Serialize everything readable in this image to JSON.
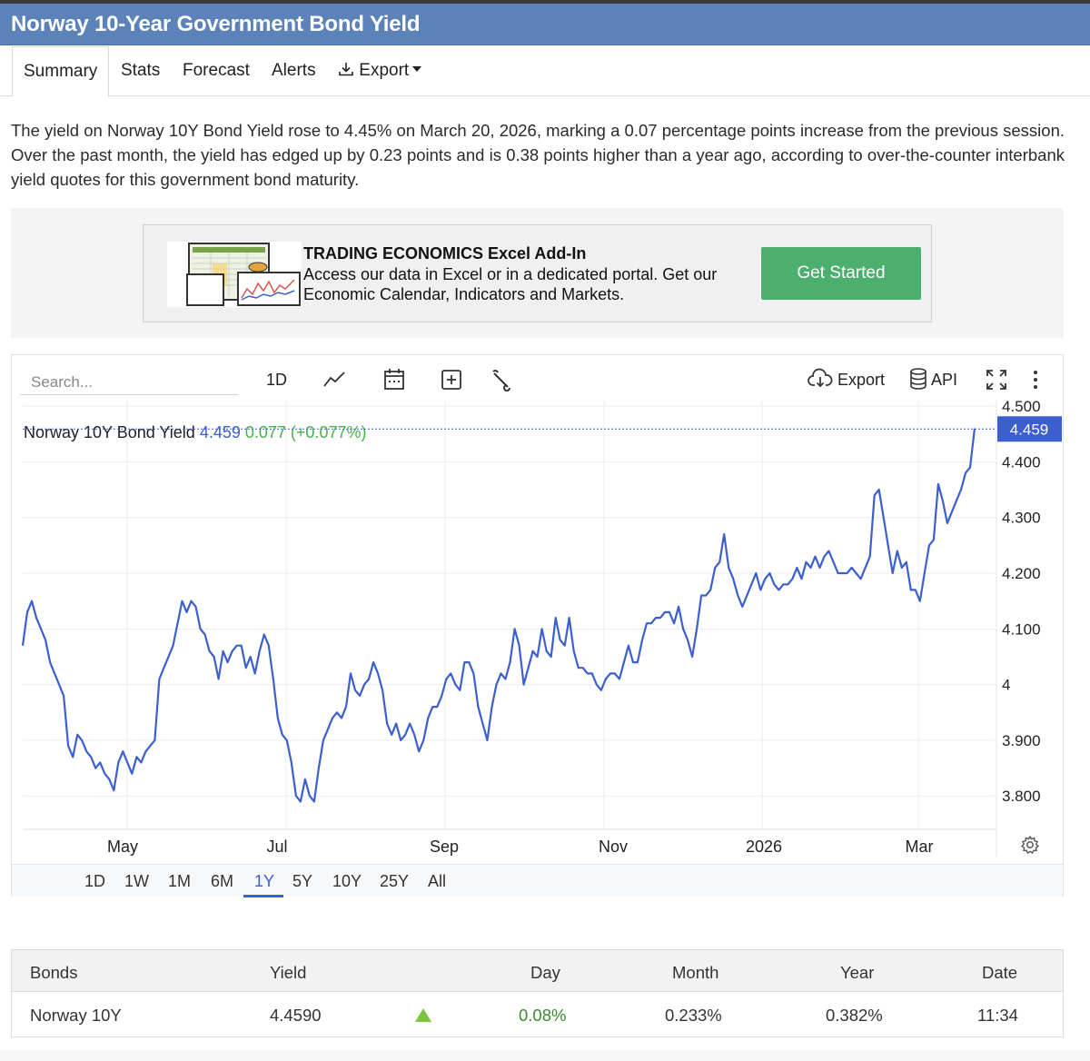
{
  "page": {
    "title": "Norway 10-Year Government Bond Yield"
  },
  "tabs": [
    {
      "label": "Summary",
      "active": true
    },
    {
      "label": "Stats"
    },
    {
      "label": "Forecast"
    },
    {
      "label": "Alerts"
    },
    {
      "label": "Export",
      "icon": "download-icon",
      "dropdown": true
    }
  ],
  "summary": "The yield on Norway 10Y Bond Yield rose to 4.45% on March 20, 2026, marking a 0.07 percentage points increase from the previous session. Over the past month, the yield has edged up by 0.23 points and is 0.38 points higher than a year ago, according to over-the-counter interbank yield quotes for this government bond maturity.",
  "ad": {
    "title": "TRADING ECONOMICS Excel Add-In",
    "text": "Access our data in Excel or in a dedicated portal. Get our Economic Calendar, Indicators and Markets.",
    "button": "Get Started",
    "button_color": "#4caf6e"
  },
  "toolbar": {
    "search_placeholder": "Search...",
    "interval": "1D",
    "export": "Export",
    "api": "API",
    "icons": [
      "chart-type-icon",
      "calendar-icon",
      "add-indicator-icon",
      "wrench-icon",
      "cloud-download-icon",
      "database-icon",
      "fullscreen-icon",
      "more-icon"
    ]
  },
  "legend": {
    "name": "Norway 10Y Bond Yield",
    "value": "4.459",
    "change": "0.077 (+0.077%)"
  },
  "colors": {
    "accent": "#3b5fcf",
    "line": "#3b5fcf",
    "up": "#45b24a",
    "header": "#5b82b9"
  },
  "chart_data": {
    "type": "line",
    "series": [
      {
        "name": "Norway 10Y Bond Yield",
        "values": [
          4.07,
          4.13,
          4.15,
          4.12,
          4.1,
          4.08,
          4.04,
          4.02,
          4.0,
          3.98,
          3.89,
          3.87,
          3.91,
          3.9,
          3.88,
          3.87,
          3.85,
          3.86,
          3.84,
          3.83,
          3.81,
          3.86,
          3.88,
          3.86,
          3.84,
          3.87,
          3.86,
          3.88,
          3.89,
          3.9,
          4.01,
          4.03,
          4.05,
          4.07,
          4.11,
          4.15,
          4.13,
          4.15,
          4.14,
          4.1,
          4.09,
          4.06,
          4.05,
          4.01,
          4.06,
          4.04,
          4.06,
          4.07,
          4.07,
          4.03,
          4.05,
          4.02,
          4.06,
          4.09,
          4.07,
          4.01,
          3.94,
          3.91,
          3.9,
          3.86,
          3.8,
          3.79,
          3.83,
          3.8,
          3.79,
          3.85,
          3.9,
          3.92,
          3.94,
          3.95,
          3.94,
          3.96,
          4.02,
          3.99,
          3.98,
          4.0,
          4.01,
          4.04,
          4.02,
          3.99,
          3.93,
          3.91,
          3.93,
          3.9,
          3.91,
          3.93,
          3.91,
          3.88,
          3.9,
          3.94,
          3.96,
          3.96,
          3.98,
          4.01,
          4.02,
          4.0,
          3.99,
          4.04,
          4.04,
          4.02,
          3.96,
          3.93,
          3.9,
          3.96,
          4.0,
          4.02,
          4.01,
          4.04,
          4.1,
          4.07,
          4.0,
          4.03,
          4.06,
          4.05,
          4.1,
          4.06,
          4.05,
          4.12,
          4.08,
          4.07,
          4.12,
          4.06,
          4.03,
          4.03,
          4.02,
          4.02,
          4.0,
          3.99,
          4.01,
          4.02,
          4.02,
          4.01,
          4.04,
          4.07,
          4.04,
          4.04,
          4.08,
          4.11,
          4.11,
          4.12,
          4.12,
          4.13,
          4.13,
          4.11,
          4.14,
          4.1,
          4.08,
          4.05,
          4.1,
          4.16,
          4.16,
          4.17,
          4.21,
          4.22,
          4.27,
          4.21,
          4.19,
          4.16,
          4.14,
          4.16,
          4.18,
          4.2,
          4.17,
          4.19,
          4.2,
          4.18,
          4.17,
          4.18,
          4.18,
          4.19,
          4.21,
          4.19,
          4.22,
          4.21,
          4.23,
          4.21,
          4.23,
          4.24,
          4.22,
          4.2,
          4.2,
          4.2,
          4.21,
          4.2,
          4.19,
          4.21,
          4.23,
          4.34,
          4.35,
          4.3,
          4.25,
          4.2,
          4.24,
          4.21,
          4.22,
          4.17,
          4.17,
          4.15,
          4.2,
          4.25,
          4.26,
          4.36,
          4.33,
          4.29,
          4.31,
          4.33,
          4.35,
          4.38,
          4.39,
          4.46
        ]
      }
    ],
    "x_ticks": [
      "May",
      "Jul",
      "Sep",
      "Nov",
      "2026",
      "Mar"
    ],
    "y_ticks": [
      "4.500",
      "4.400",
      "4.300",
      "4.200",
      "4.100",
      "4",
      "3.900",
      "3.800"
    ],
    "ylim": [
      3.74,
      4.51
    ],
    "y_tick_values": [
      4.5,
      4.4,
      4.3,
      4.2,
      4.1,
      4.0,
      3.9,
      3.8
    ],
    "last_value_label": "4.459",
    "last_value": 4.459,
    "grid": true,
    "legend": "top-left"
  },
  "ranges": [
    {
      "label": "1D"
    },
    {
      "label": "1W"
    },
    {
      "label": "1M"
    },
    {
      "label": "6M"
    },
    {
      "label": "1Y",
      "active": true
    },
    {
      "label": "5Y"
    },
    {
      "label": "10Y"
    },
    {
      "label": "25Y"
    },
    {
      "label": "All"
    }
  ],
  "table": {
    "headers": [
      "Bonds",
      "Yield",
      "Day",
      "Month",
      "Year",
      "Date"
    ],
    "row": {
      "bond": "Norway 10Y",
      "yield": "4.4590",
      "day": "0.08%",
      "month": "0.233%",
      "year": "0.382%",
      "date": "11:34",
      "trend": "up"
    }
  }
}
